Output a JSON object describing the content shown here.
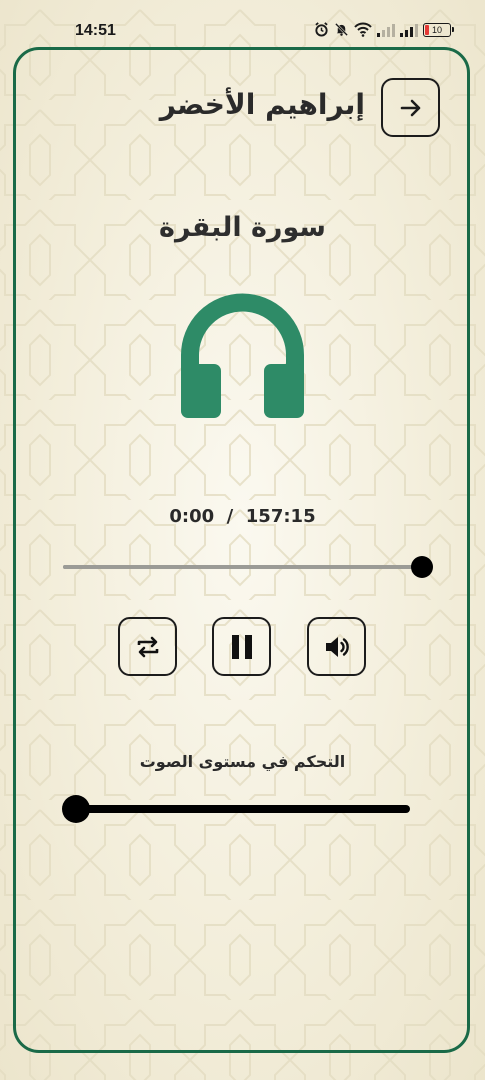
{
  "status_bar": {
    "time": "14:51",
    "icons": [
      "alarm-icon",
      "bell-muted-icon",
      "wifi-icon",
      "signal-icon",
      "signal-icon",
      "battery-icon"
    ],
    "battery": "10",
    "battery_color": "#e53935"
  },
  "header": {
    "reciter_name": "إبراهيم الأخضر",
    "back_icon": "arrow-right-icon"
  },
  "player": {
    "surah_name": "سورة البقرة",
    "art_icon": "headphones-icon",
    "time_text": "0:00  /  157:15",
    "progress_fraction": 1.0,
    "controls": {
      "repeat_icon": "repeat-icon",
      "pause_icon": "pause-icon",
      "volume_icon": "volume-icon"
    },
    "volume_label": "التحكم في مستوى الصوت",
    "volume_fraction": 0.0
  },
  "colors": {
    "accent": "#2e8b67",
    "border": "#1a6a48",
    "background": "#f3eedb"
  }
}
